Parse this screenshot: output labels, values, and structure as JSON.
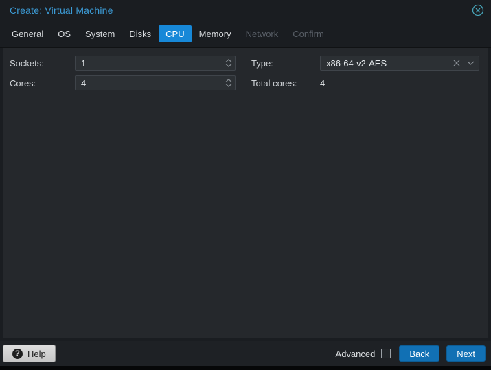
{
  "window": {
    "title": "Create: Virtual Machine"
  },
  "tabs": {
    "items": [
      {
        "label": "General",
        "state": "normal"
      },
      {
        "label": "OS",
        "state": "normal"
      },
      {
        "label": "System",
        "state": "normal"
      },
      {
        "label": "Disks",
        "state": "normal"
      },
      {
        "label": "CPU",
        "state": "active"
      },
      {
        "label": "Memory",
        "state": "normal"
      },
      {
        "label": "Network",
        "state": "disabled"
      },
      {
        "label": "Confirm",
        "state": "disabled"
      }
    ]
  },
  "form": {
    "sockets": {
      "label": "Sockets:",
      "value": "1"
    },
    "cores": {
      "label": "Cores:",
      "value": "4"
    },
    "type": {
      "label": "Type:",
      "value": "x86-64-v2-AES"
    },
    "total_cores": {
      "label": "Total cores:",
      "value": "4"
    }
  },
  "footer": {
    "help_label": "Help",
    "help_icon_glyph": "?",
    "advanced_label": "Advanced",
    "advanced_checked": false,
    "back_label": "Back",
    "next_label": "Next"
  },
  "icons": {
    "close": "circle-x-icon",
    "clear": "x-icon",
    "dropdown": "chevron-down-icon",
    "spinner_up": "chevron-up-icon",
    "spinner_down": "chevron-down-icon",
    "help": "question-circle-icon"
  },
  "colors": {
    "title_blue": "#3c9cd7",
    "active_tab_blue": "#1788d8",
    "primary_button_blue": "#1170b4",
    "close_icon_teal": "#47a4b8",
    "content_background": "#25282c",
    "header_background": "#1a1d21",
    "field_background": "#2c3034"
  }
}
